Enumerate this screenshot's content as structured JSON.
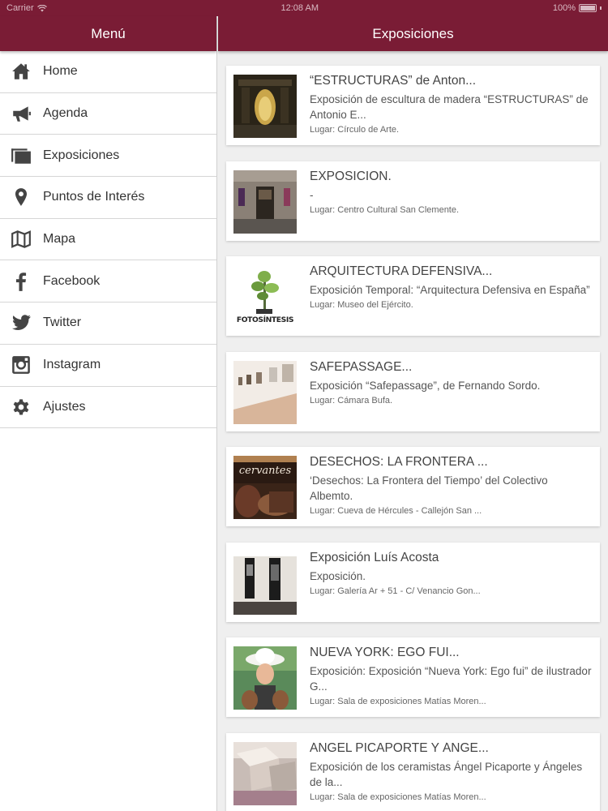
{
  "status_bar": {
    "carrier": "Carrier",
    "time": "12:08 AM",
    "battery": "100%"
  },
  "sidebar": {
    "title": "Menú",
    "items": [
      {
        "label": "Home",
        "icon": "home-icon"
      },
      {
        "label": "Agenda",
        "icon": "megaphone-icon"
      },
      {
        "label": "Exposiciones",
        "icon": "gallery-icon"
      },
      {
        "label": "Puntos de Interés",
        "icon": "map-pin-icon"
      },
      {
        "label": "Mapa",
        "icon": "map-icon"
      },
      {
        "label": "Facebook",
        "icon": "facebook-icon"
      },
      {
        "label": "Twitter",
        "icon": "twitter-icon"
      },
      {
        "label": "Instagram",
        "icon": "instagram-icon"
      },
      {
        "label": "Ajustes",
        "icon": "gear-icon"
      }
    ]
  },
  "main": {
    "title": "Exposiciones",
    "cards": [
      {
        "title": "“ESTRUCTURAS” de Anton...",
        "description": "Exposición de escultura de madera “ESTRUCTURAS” de Antonio E...",
        "place": "Lugar: Círculo de Arte."
      },
      {
        "title": "EXPOSICIÓN.",
        "description": "-",
        "place": "Lugar: Centro Cultural San Clemente."
      },
      {
        "title": "ARQUITECTURA DEFENSIVA...",
        "description": "Exposición Temporal: “Arquitectura Defensiva en España”",
        "place": "Lugar: Museo del Ejército."
      },
      {
        "title": "SAFEPASSAGE...",
        "description": "Exposición “Safepassage”, de Fernando Sordo.",
        "place": "Lugar: Cámara Bufa."
      },
      {
        "title": "DESECHOS: LA FRONTERA ...",
        "description": "‘Desechos: La Frontera del Tiempo’ del Colectivo Albemto.",
        "place": "Lugar: Cueva de Hércules - Callejón San ..."
      },
      {
        "title": "Exposición Luís Acosta",
        "description": "Exposición.",
        "place": "Lugar: Galería Ar + 51 - C/ Venancio Gon..."
      },
      {
        "title": "NUEVA YORK: EGO FUI...",
        "description": "Exposición: Exposición “Nueva York: Ego fui” de ilustrador G...",
        "place": "Lugar: Sala de exposiciones Matías Moren..."
      },
      {
        "title": "ÁNGEL PICAPORTE Y ÁNGE...",
        "description": "Exposición de los ceramistas Ángel Picaporte y Ángeles de la...",
        "place": "Lugar: Sala de exposiciones Matías Moren..."
      }
    ],
    "thumb_texts": {
      "fotosintesis": "FOTOSÍNTESIS",
      "cervantes": "cervantes"
    }
  },
  "colors": {
    "brand": "#7a1c35",
    "background": "#efefef"
  }
}
